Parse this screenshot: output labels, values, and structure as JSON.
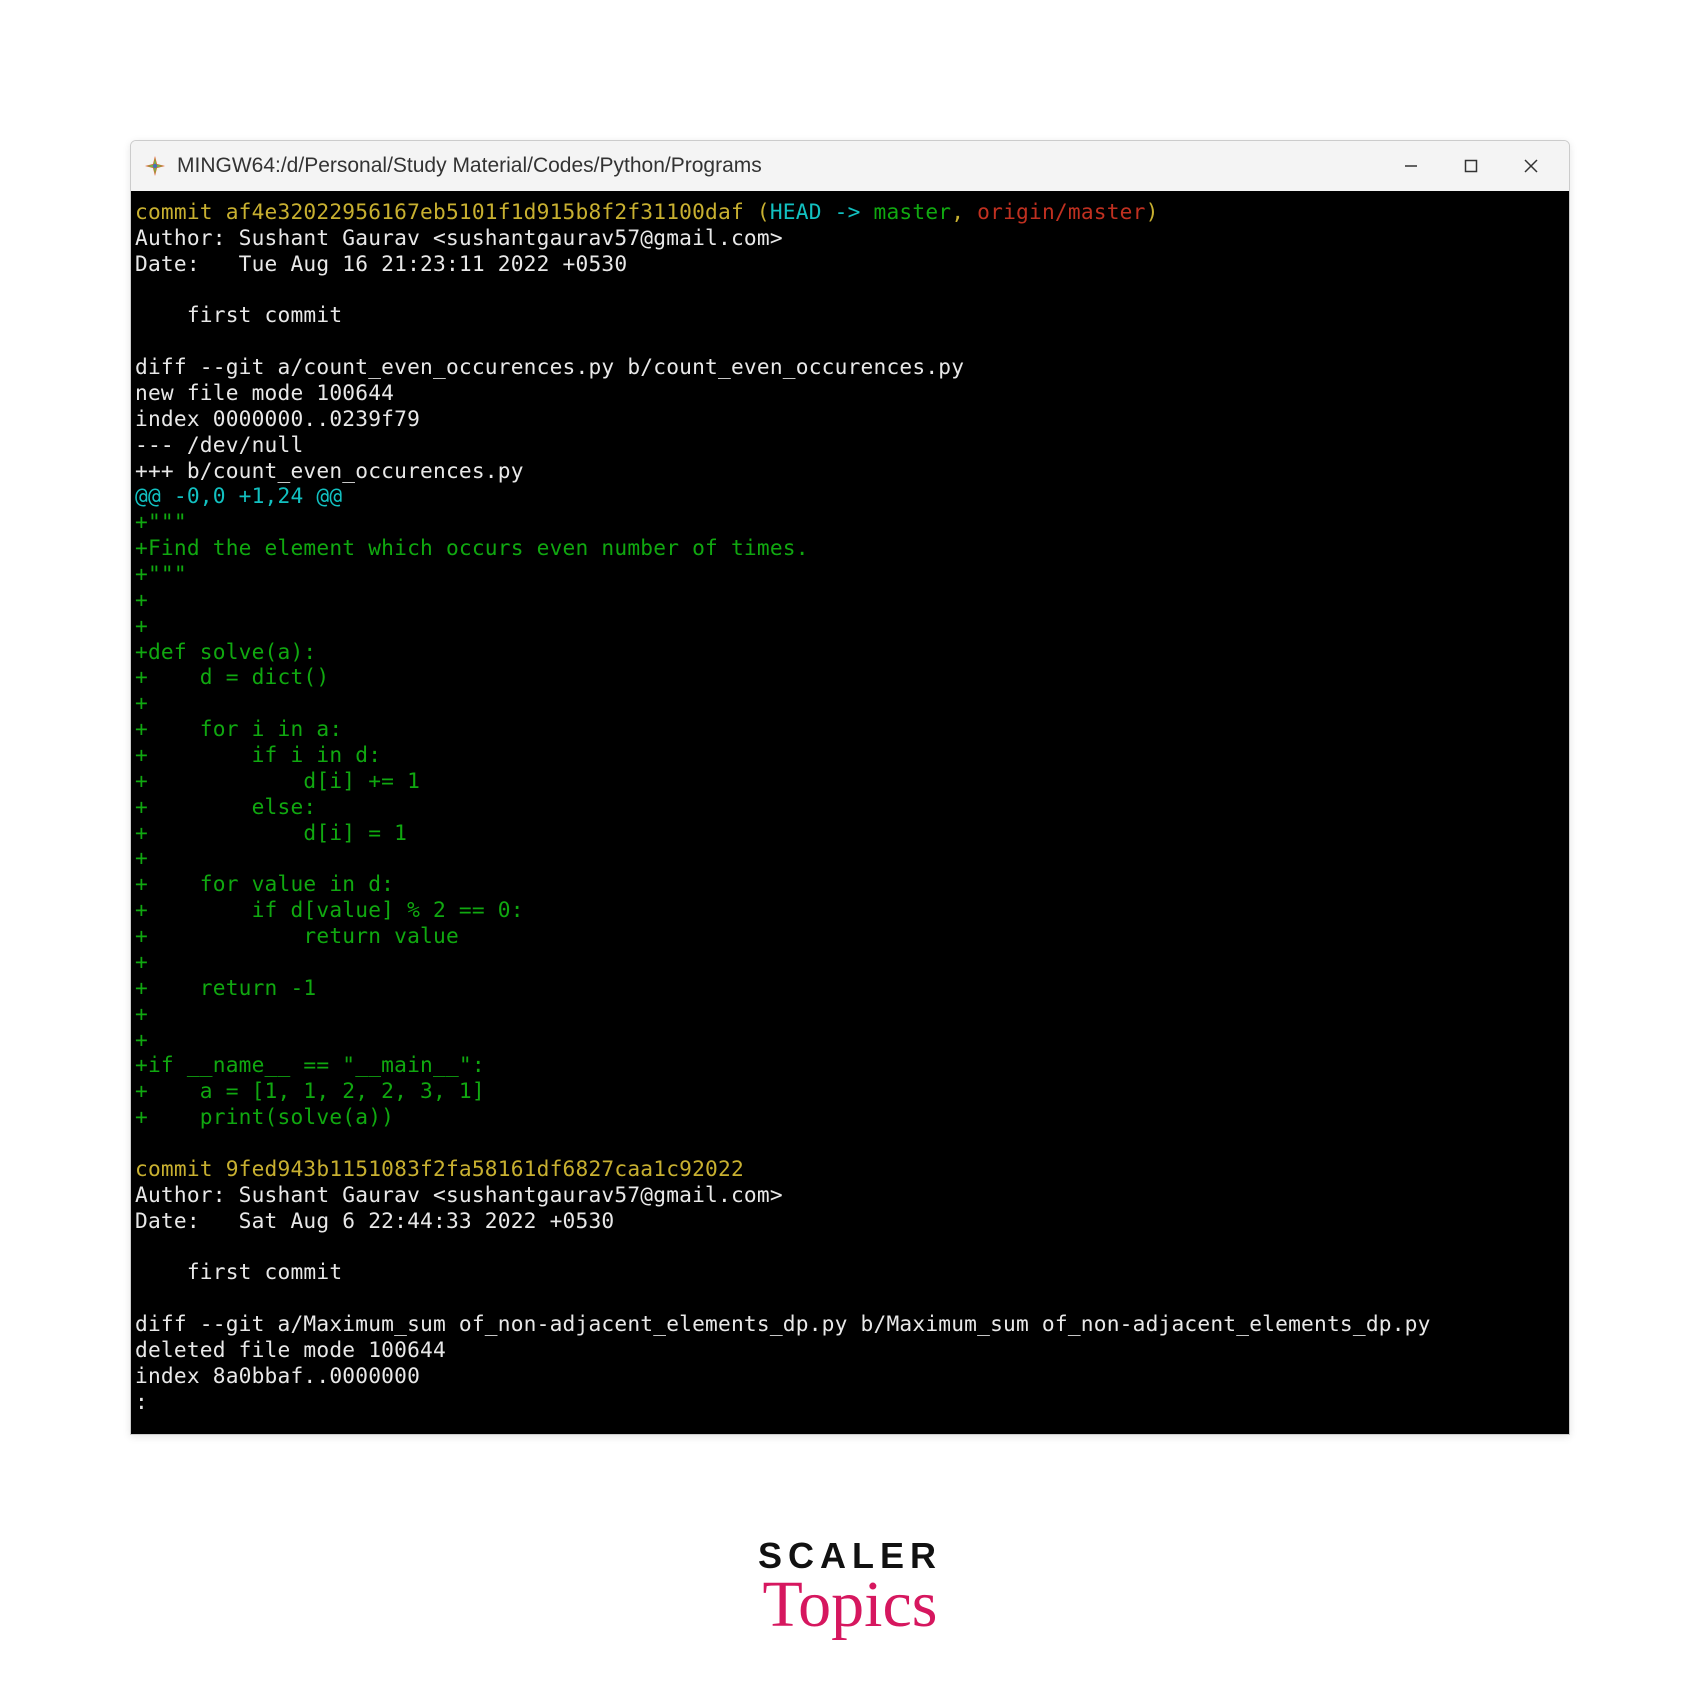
{
  "window": {
    "title": "MINGW64:/d/Personal/Study Material/Codes/Python/Programs"
  },
  "logo": {
    "line1": "SCALER",
    "line2": "Topics"
  },
  "terminal": {
    "commit1": {
      "prefix": "commit af4e32022956167eb5101f1d915b8f2f31100daf (",
      "head": "HEAD -> ",
      "master": "master",
      "sep": ", ",
      "origin": "origin/master",
      "close": ")",
      "author": "Author: Sushant Gaurav <sushantgaurav57@gmail.com>",
      "date": "Date:   Tue Aug 16 21:23:11 2022 +0530",
      "msg": "    first commit"
    },
    "diff1": {
      "l1": "diff --git a/count_even_occurences.py b/count_even_occurences.py",
      "l2": "new file mode 100644",
      "l3": "index 0000000..0239f79",
      "l4": "--- /dev/null",
      "l5": "+++ b/count_even_occurences.py",
      "hunk": "@@ -0,0 +1,24 @@"
    },
    "added": {
      "a01": "+\"\"\"",
      "a02": "+Find the element which occurs even number of times.",
      "a03": "+\"\"\"",
      "a04": "+",
      "a05": "+",
      "a06": "+def solve(a):",
      "a07": "+    d = dict()",
      "a08": "+",
      "a09": "+    for i in a:",
      "a10": "+        if i in d:",
      "a11": "+            d[i] += 1",
      "a12": "+        else:",
      "a13": "+            d[i] = 1",
      "a14": "+",
      "a15": "+    for value in d:",
      "a16": "+        if d[value] % 2 == 0:",
      "a17": "+            return value",
      "a18": "+",
      "a19": "+    return -1",
      "a20": "+",
      "a21": "+",
      "a22": "+if __name__ == \"__main__\":",
      "a23": "+    a = [1, 1, 2, 2, 3, 1]",
      "a24": "+    print(solve(a))"
    },
    "commit2": {
      "line": "commit 9fed943b1151083f2fa58161df6827caa1c92022",
      "author": "Author: Sushant Gaurav <sushantgaurav57@gmail.com>",
      "date": "Date:   Sat Aug 6 22:44:33 2022 +0530",
      "msg": "    first commit"
    },
    "diff2": {
      "l1": "diff --git a/Maximum_sum of_non-adjacent_elements_dp.py b/Maximum_sum of_non-adjacent_elements_dp.py",
      "l2": "deleted file mode 100644",
      "l3": "index 8a0bbaf..0000000",
      "l4": ":"
    }
  }
}
